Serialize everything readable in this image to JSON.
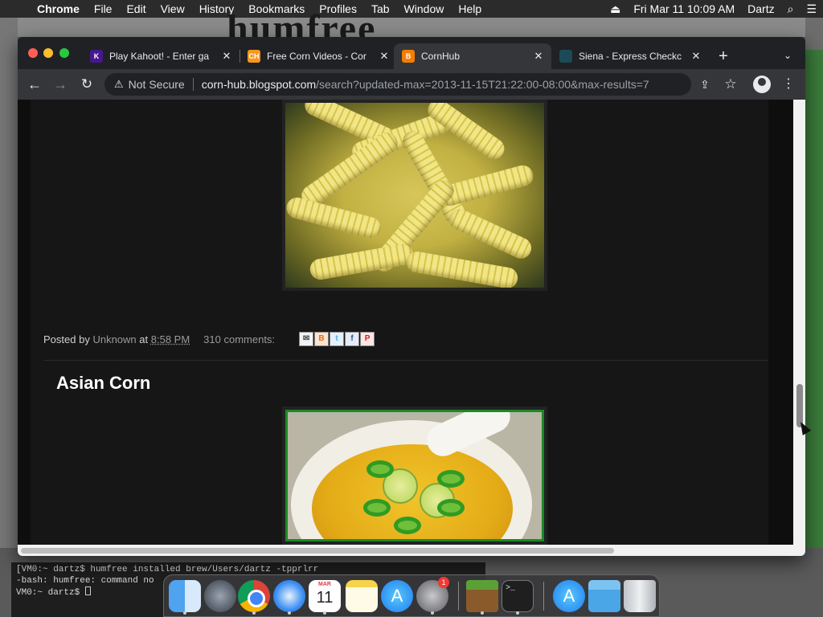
{
  "menubar": {
    "app_name": "Chrome",
    "items": [
      "File",
      "Edit",
      "View",
      "History",
      "Bookmarks",
      "Profiles",
      "Tab",
      "Window",
      "Help"
    ],
    "clock": "Fri Mar 11  10:09 AM",
    "user": "Dartz"
  },
  "tabs": [
    {
      "title": "Play Kahoot! - Enter ga",
      "favicon": "kahoot-icon",
      "favicon_color": "#46178f",
      "favicon_text": "K"
    },
    {
      "title": "Free Corn Videos - Cor",
      "favicon": "cornhub-icon",
      "favicon_color": "#f7971d",
      "favicon_text": "CH"
    },
    {
      "title": "CornHub",
      "favicon": "blogger-icon",
      "favicon_color": "#f57d00",
      "favicon_text": "B",
      "active": true
    },
    {
      "title": "Siena - Express Checkc",
      "favicon": "siena-icon",
      "favicon_color": "#1b4b57",
      "favicon_text": ""
    }
  ],
  "toolbar": {
    "security_label": "Not Secure",
    "url_host": "corn-hub.blogspot.com",
    "url_path": "/search?updated-max=2013-11-15T21:22:00-08:00&max-results=7"
  },
  "post": {
    "footer_posted_by": "Posted by",
    "author": "Unknown",
    "at": "at",
    "time": "8:58 PM",
    "comments": "310 comments:",
    "share": [
      "email-share-icon",
      "blogthis-icon",
      "twitter-share-icon",
      "facebook-share-icon",
      "pinterest-share-icon"
    ]
  },
  "next_post": {
    "title": "Asian Corn"
  },
  "terminal": {
    "lines": [
      "[VM0:~ dartz$ humfree installed brew/Users/dartz -tpprlrr",
      "-bash: humfree: command no",
      "VM0:~ dartz$ "
    ]
  },
  "dock": {
    "calendar_month": "MAR",
    "calendar_day": "11",
    "sysprefs_badge": "1",
    "apps": [
      "finder-icon",
      "launchpad-icon",
      "chrome-icon",
      "safari-icon",
      "calendar-icon",
      "notes-icon",
      "app-store-icon",
      "system-preferences-icon",
      "minecraft-icon",
      "terminal-icon",
      "app-store-icon",
      "downloads-folder-icon",
      "trash-icon"
    ]
  }
}
